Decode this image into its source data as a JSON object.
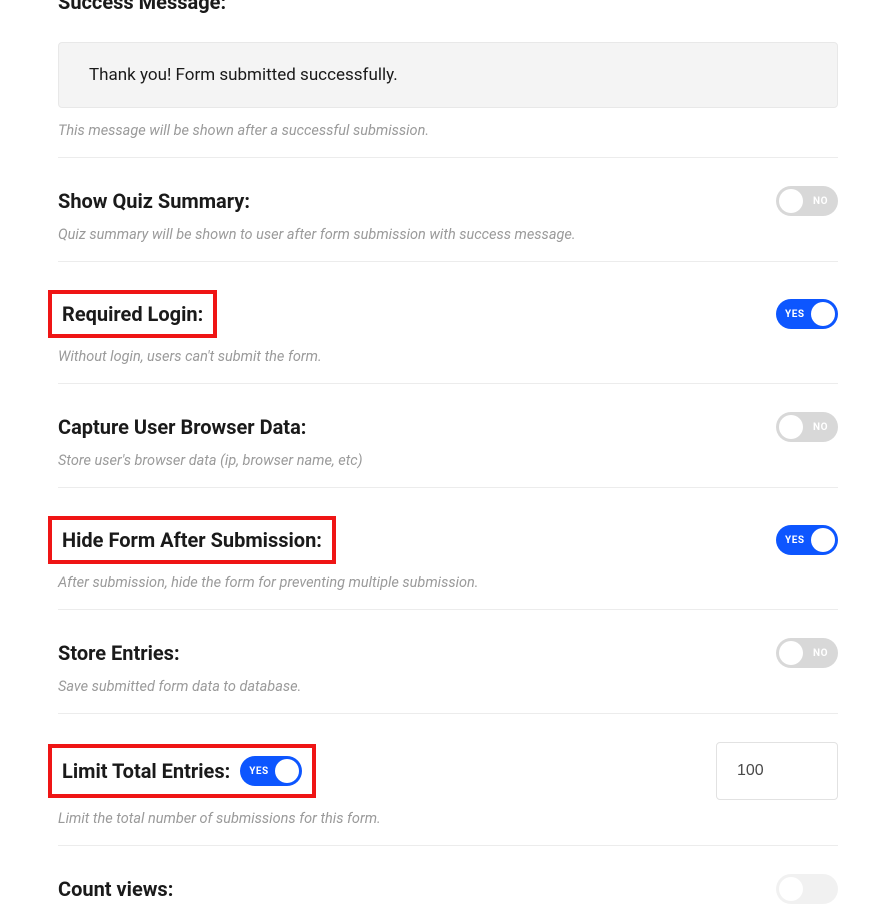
{
  "partialHeading": "Success Message:",
  "messageBox": {
    "text": "Thank you! Form submitted successfully."
  },
  "successHelp": "This message will be shown after a successful submission.",
  "settings": {
    "quizSummary": {
      "label": "Show Quiz Summary:",
      "help": "Quiz summary will be shown to user after form submission with success message.",
      "toggleText": "NO"
    },
    "requiredLogin": {
      "label": "Required Login:",
      "help": "Without login, users can't submit the form.",
      "toggleText": "YES"
    },
    "captureBrowser": {
      "label": "Capture User Browser Data:",
      "help": "Store user's browser data (ip, browser name, etc)",
      "toggleText": "NO"
    },
    "hideForm": {
      "label": "Hide Form After Submission:",
      "help": "After submission, hide the form for preventing multiple submission.",
      "toggleText": "YES"
    },
    "storeEntries": {
      "label": "Store Entries:",
      "help": "Save submitted form data to database.",
      "toggleText": "NO"
    },
    "limitEntries": {
      "label": "Limit Total Entries:",
      "help": "Limit the total number of submissions for this form.",
      "toggleText": "YES",
      "value": "100"
    },
    "countViews": {
      "label": "Count views:"
    }
  }
}
